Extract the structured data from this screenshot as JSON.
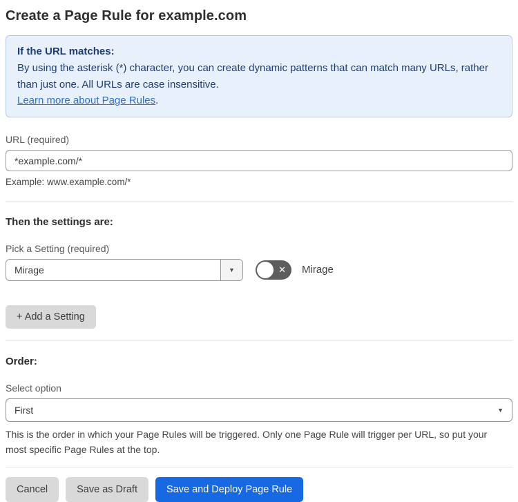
{
  "page": {
    "title": "Create a Page Rule for example.com"
  },
  "info_box": {
    "heading": "If the URL matches:",
    "body": "By using the asterisk (*) character, you can create dynamic patterns that can match many URLs, rather than just one. All URLs are case insensitive.",
    "link_label": "Learn more about Page Rules",
    "link_suffix": "."
  },
  "url_field": {
    "label": "URL (required)",
    "value": "*example.com/*",
    "helper": "Example: www.example.com/*"
  },
  "settings_section": {
    "heading": "Then the settings are:",
    "picker_label": "Pick a Setting (required)",
    "picker_value": "Mirage",
    "picker_arrow": "▼",
    "toggle_state": "off",
    "toggle_x": "✕",
    "toggle_label": "Mirage",
    "add_button_label": "+ Add a Setting"
  },
  "order_section": {
    "heading": "Order:",
    "select_label": "Select option",
    "select_value": "First",
    "select_caret": "▼",
    "helper": "This is the order in which your Page Rules will be triggered. Only one Page Rule will trigger per URL, so put your most specific Page Rules at the top."
  },
  "footer": {
    "cancel_label": "Cancel",
    "save_draft_label": "Save as Draft",
    "save_deploy_label": "Save and Deploy Page Rule"
  },
  "colors": {
    "accent_blue": "#1668e3",
    "info_bg": "#e8f1fb",
    "info_border": "#b0cfee",
    "info_text": "#1e3c74",
    "link_blue": "#2e6fd2",
    "toggle_off_gray": "#5d5d5d",
    "button_gray": "#d9d9d9"
  }
}
